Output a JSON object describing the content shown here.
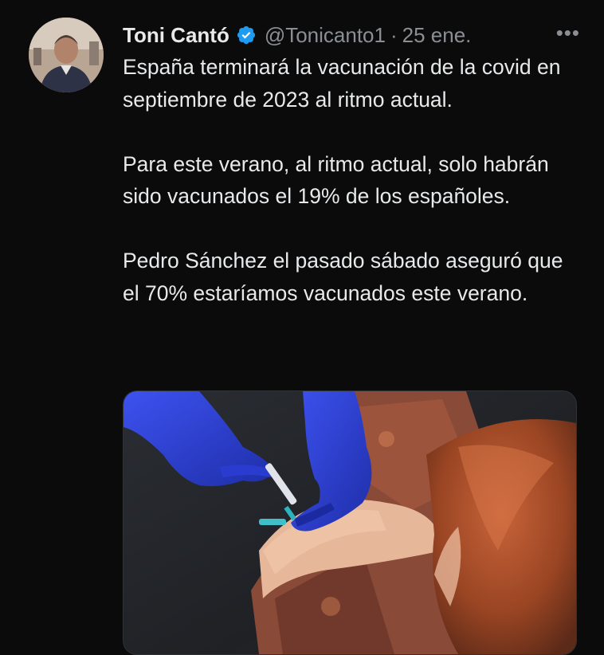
{
  "tweet": {
    "author_name": "Toni Cantó",
    "verified": true,
    "handle": "@Tonicanto1",
    "separator": "·",
    "time": "25 ene.",
    "more_label": "•••",
    "paragraphs": [
      "España terminará la vacunación de la covid en septiembre de 2023 al ritmo actual.",
      "Para este verano, al ritmo actual, solo habrán sido vacunados el 19% de los españoles.",
      "Pedro Sánchez el pasado sábado aseguró que el 70% estaríamos  vacunados este verano."
    ]
  },
  "icons": {
    "verified": "verified-badge-icon",
    "more": "more-options-icon"
  },
  "colors": {
    "background": "#0b0b0c",
    "text": "#e7e9ea",
    "secondary_text": "#8b8f94",
    "verified_blue": "#1d9bf0",
    "glove_blue": "#2b3fd6"
  }
}
